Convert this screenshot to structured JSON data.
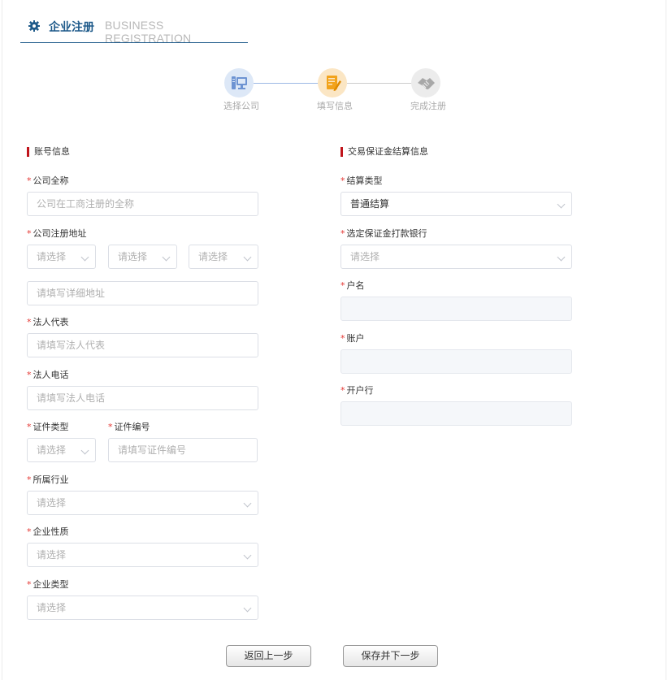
{
  "header": {
    "title": "企业注册",
    "subtitle": "BUSINESS REGISTRATION"
  },
  "steps": [
    {
      "label": "选择公司",
      "icon": "computer-icon",
      "color": "#9cb8e4"
    },
    {
      "label": "填写信息",
      "icon": "form-edit-icon",
      "color": "#f5b940"
    },
    {
      "label": "完成注册",
      "icon": "handshake-icon",
      "color": "#c8c8c8"
    }
  ],
  "account": {
    "section_title": "账号信息",
    "company_name": {
      "label": "公司全称",
      "placeholder": "公司在工商注册的全称"
    },
    "address": {
      "label": "公司注册地址",
      "province": "请选择",
      "city": "请选择",
      "district": "请选择",
      "detail_placeholder": "请填写详细地址"
    },
    "legal_rep": {
      "label": "法人代表",
      "placeholder": "请填写法人代表"
    },
    "legal_phone": {
      "label": "法人电话",
      "placeholder": "请填写法人电话"
    },
    "id_type": {
      "label": "证件类型",
      "value": "请选择"
    },
    "id_number": {
      "label": "证件编号",
      "placeholder": "请填写证件编号"
    },
    "industry": {
      "label": "所属行业",
      "value": "请选择"
    },
    "nature": {
      "label": "企业性质",
      "value": "请选择"
    },
    "type": {
      "label": "企业类型",
      "value": "请选择"
    }
  },
  "settlement": {
    "section_title": "交易保证金结算信息",
    "settle_type": {
      "label": "结算类型",
      "value": "普通结算"
    },
    "bank": {
      "label": "选定保证金打款银行",
      "value": "请选择"
    },
    "account_name": {
      "label": "户名",
      "value": ""
    },
    "account_no": {
      "label": "账户",
      "value": ""
    },
    "bank_branch": {
      "label": "开户行",
      "value": ""
    }
  },
  "buttons": {
    "back": "返回上一步",
    "save_next": "保存并下一步"
  },
  "colors": {
    "accent": "#1e5a8a",
    "required": "#e53935",
    "section_marker": "#c0141b"
  }
}
